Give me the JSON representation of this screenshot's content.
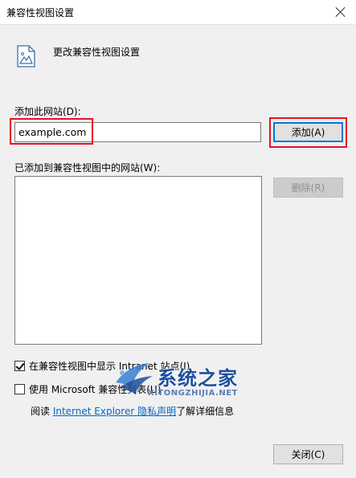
{
  "window": {
    "title": "兼容性视图设置"
  },
  "header": {
    "icon": "document-image-icon",
    "text": "更改兼容性视图设置"
  },
  "add_site": {
    "label": "添加此网站(D):",
    "value": "example.com",
    "button": "添加(A)"
  },
  "list": {
    "label": "已添加到兼容性视图中的网站(W):",
    "items": [],
    "remove_button": "删除(R)"
  },
  "options": {
    "intranet": {
      "label": "在兼容性视图中显示 Intranet 站点(I)",
      "checked": true
    },
    "microsoft": {
      "label": "使用 Microsoft 兼容性列表(U)",
      "checked": false
    }
  },
  "privacy": {
    "prefix": "阅读 ",
    "link": "Internet Explorer 隐私声明",
    "suffix": "了解详细信息"
  },
  "footer": {
    "close_button": "关闭(C)"
  },
  "watermark": {
    "text": "系统之家",
    "url": "XITONGZHIJIA.NET"
  },
  "colors": {
    "highlight_red": "#e81123",
    "link_blue": "#0066cc",
    "focus_blue": "#0078d7"
  }
}
